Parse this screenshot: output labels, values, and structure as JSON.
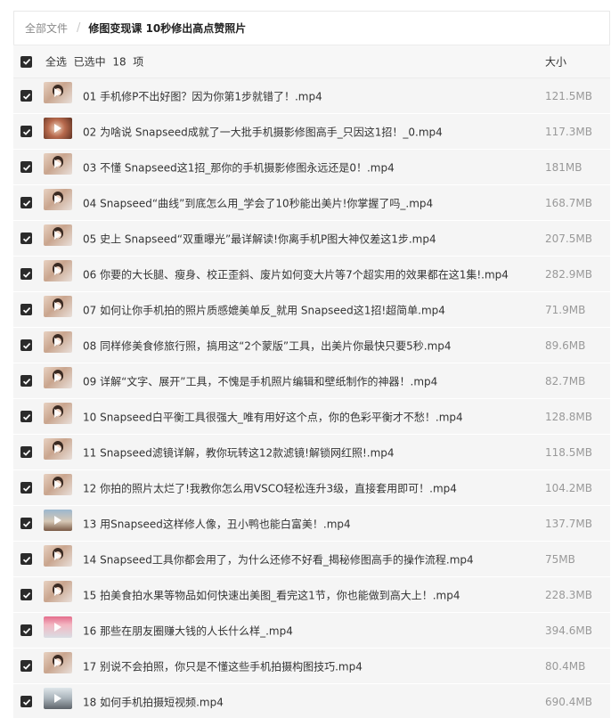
{
  "breadcrumb": {
    "root": "全部文件",
    "separator": "/",
    "current": "修图变现课 10秒修出高点赞照片"
  },
  "header": {
    "select_all": "全选",
    "selected_text": "已选中",
    "selected_count": "18",
    "unit": "项",
    "size_label": "大小"
  },
  "files": [
    {
      "name": "01 手机修P不出好图？因为你第1步就错了！.mp4",
      "size": "121.5MB",
      "thumb": "face"
    },
    {
      "name": "02 为啥说 Snapseed成就了一大批手机摄影修图高手_只因这1招！_0.mp4",
      "size": "117.3MB",
      "thumb": "swirl"
    },
    {
      "name": "03 不懂 Snapseed这1招_那你的手机摄影修图永远还是0！.mp4",
      "size": "181MB",
      "thumb": "face"
    },
    {
      "name": "04 Snapseed“曲线”到底怎么用_学会了10秒能出美片!你掌握了吗_.mp4",
      "size": "168.7MB",
      "thumb": "face"
    },
    {
      "name": "05 史上 Snapseed“双重曝光”最详解读!你离手机P图大神仅差这1步.mp4",
      "size": "207.5MB",
      "thumb": "face"
    },
    {
      "name": "06 你要的大长腿、瘦身、校正歪斜、废片如何变大片等7个超实用的效果都在这1集!.mp4",
      "size": "282.9MB",
      "thumb": "face"
    },
    {
      "name": "07 如何让你手机拍的照片质感媲美单反_就用 Snapseed这1招!超简单.mp4",
      "size": "71.9MB",
      "thumb": "face"
    },
    {
      "name": "08 同样修美食修旅行照，搞用这“2个蒙版”工具，出美片你最快只要5秒.mp4",
      "size": "89.6MB",
      "thumb": "face"
    },
    {
      "name": "09 详解“文字、展开”工具，不愧是手机照片编辑和壁纸制作的神器！.mp4",
      "size": "82.7MB",
      "thumb": "face"
    },
    {
      "name": "10 Snapseed白平衡工具很强大_唯有用好这个点，你的色彩平衡才不愁！.mp4",
      "size": "128.8MB",
      "thumb": "face"
    },
    {
      "name": "11 Snapseed滤镜详解，教你玩转这12款滤镜!解锁网红照!.mp4",
      "size": "118.5MB",
      "thumb": "face"
    },
    {
      "name": "12 你拍的照片太烂了!我教你怎么用VSCO轻松连升3级，直接套用即可！.mp4",
      "size": "104.2MB",
      "thumb": "face"
    },
    {
      "name": "13 用Snapseed这样修人像，丑小鸭也能白富美！.mp4",
      "size": "137.7MB",
      "thumb": "scene"
    },
    {
      "name": "14 Snapseed工具你都会用了，为什么还修不好看_揭秘修图高手的操作流程.mp4",
      "size": "75MB",
      "thumb": "face"
    },
    {
      "name": "15 拍美食拍水果等物品如何快速出美图_看完这1节，你也能做到高大上！.mp4",
      "size": "228.3MB",
      "thumb": "face"
    },
    {
      "name": "16 那些在朋友圈赚大钱的人长什么样_.mp4",
      "size": "394.6MB",
      "thumb": "pink"
    },
    {
      "name": "17 别说不会拍照，你只是不懂这些手机拍摄构图技巧.mp4",
      "size": "80.4MB",
      "thumb": "face"
    },
    {
      "name": "18 如何手机拍摄短视频.mp4",
      "size": "690.4MB",
      "thumb": "city"
    }
  ]
}
